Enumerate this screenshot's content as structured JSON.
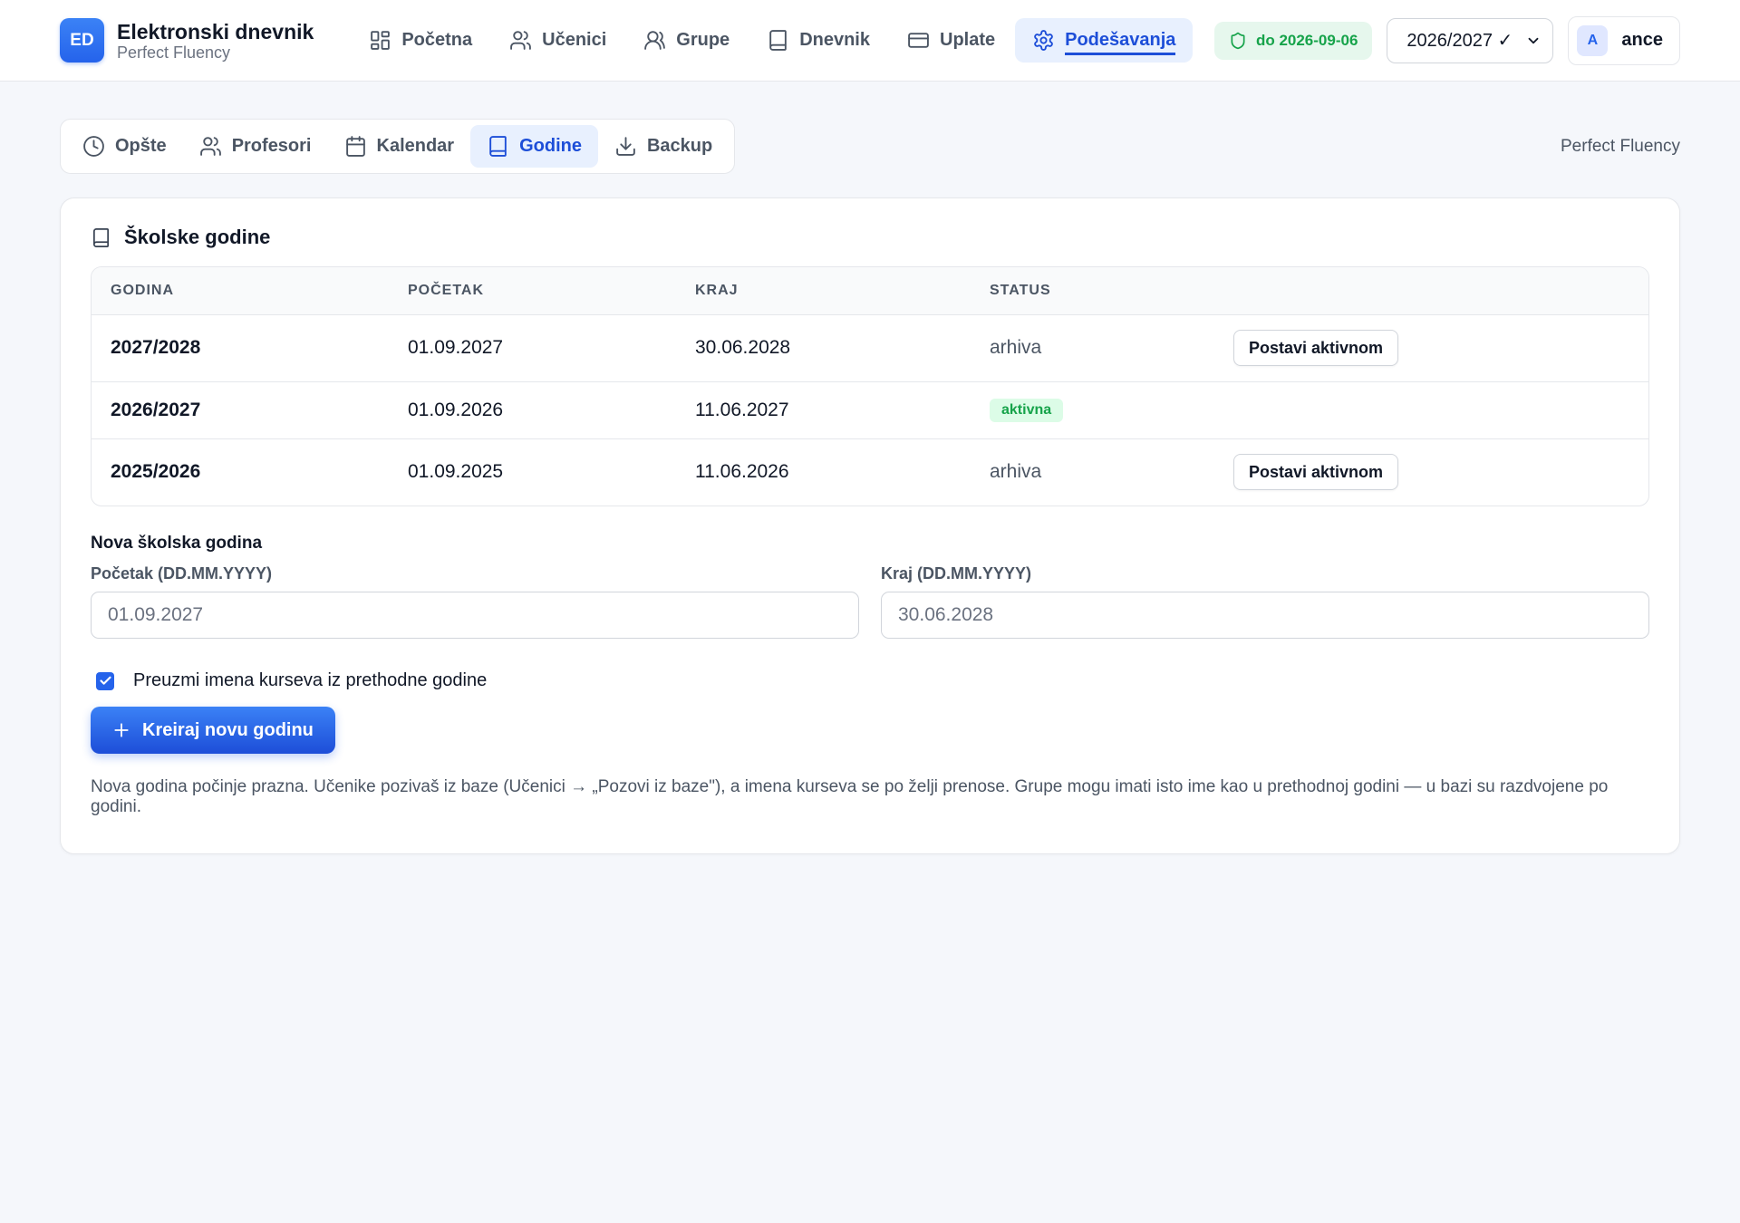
{
  "app": {
    "logo_text": "ED",
    "title": "Elektronski dnevnik",
    "subtitle": "Perfect Fluency"
  },
  "nav": [
    {
      "label": "Početna",
      "icon": "grid-icon"
    },
    {
      "label": "Učenici",
      "icon": "users-icon"
    },
    {
      "label": "Grupe",
      "icon": "user-group-icon"
    },
    {
      "label": "Dnevnik",
      "icon": "book-icon"
    },
    {
      "label": "Uplate",
      "icon": "credit-card-icon"
    },
    {
      "label": "Podešavanja",
      "icon": "gear-icon",
      "active": true
    }
  ],
  "license": {
    "label": "do 2026-09-06",
    "icon": "shield-icon"
  },
  "year_select": {
    "value": "2026/2027 ✓"
  },
  "user": {
    "avatar": "A",
    "name": "ance"
  },
  "tabs": [
    {
      "label": "Opšte",
      "icon": "clock-icon"
    },
    {
      "label": "Profesori",
      "icon": "users-icon"
    },
    {
      "label": "Kalendar",
      "icon": "calendar-icon"
    },
    {
      "label": "Godine",
      "icon": "book-icon",
      "active": true
    },
    {
      "label": "Backup",
      "icon": "download-icon"
    }
  ],
  "org_name": "Perfect Fluency",
  "card": {
    "title": "Školske godine",
    "columns": [
      "GODINA",
      "POČETAK",
      "KRAJ",
      "STATUS"
    ],
    "rows": [
      {
        "year": "2027/2028",
        "start": "01.09.2027",
        "end": "30.06.2028",
        "status": "arhiva",
        "action": "Postavi aktivnom"
      },
      {
        "year": "2026/2027",
        "start": "01.09.2026",
        "end": "11.06.2027",
        "status": "aktivna"
      },
      {
        "year": "2025/2026",
        "start": "01.09.2025",
        "end": "11.06.2026",
        "status": "arhiva",
        "action": "Postavi aktivnom"
      }
    ]
  },
  "new_year": {
    "title": "Nova školska godina",
    "start_label": "Početak (DD.MM.YYYY)",
    "start_placeholder": "01.09.2027",
    "end_label": "Kraj (DD.MM.YYYY)",
    "end_placeholder": "30.06.2028",
    "checkbox_label": "Preuzmi imena kurseva iz prethodne godine",
    "checkbox_checked": true,
    "create_button": "Kreiraj novu godinu",
    "help_text": "Nova godina počinje prazna. Učenike pozivaš iz baze (Učenici → „Pozovi iz baze\"), a imena kurseva se po želji prenose. Grupe mogu imati isto ime kao u prethodnoj godini — u bazi su razdvojene po godini."
  },
  "colors": {
    "accent": "#2563eb",
    "active_bg": "#e8f0fe",
    "success": "#16a34a",
    "success_bg": "#dcfce7",
    "page_bg": "#f5f7fb"
  }
}
